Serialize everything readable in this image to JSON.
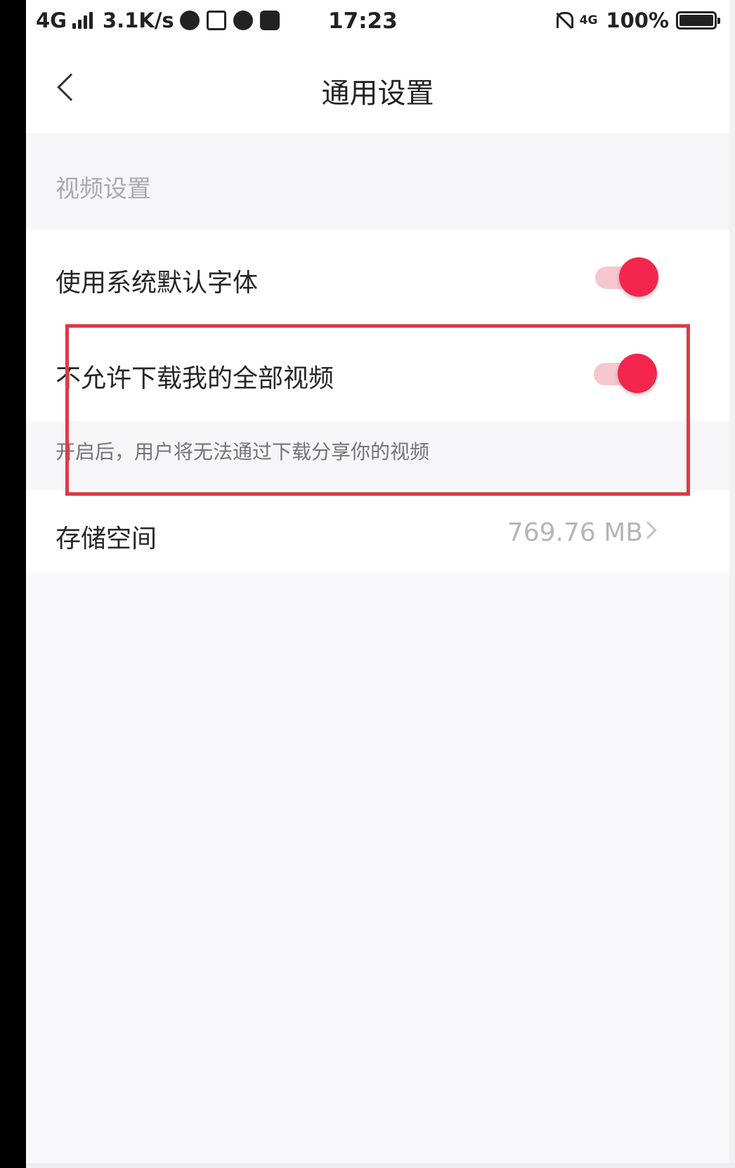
{
  "status_bar": {
    "network": "4G",
    "speed": "3.1K/s",
    "time": "17:23",
    "network_right": "4G",
    "battery": "100%"
  },
  "nav": {
    "title": "通用设置",
    "back_icon": "chevron-left-icon"
  },
  "section": {
    "title": "视频设置"
  },
  "settings": [
    {
      "label": "使用系统默认字体",
      "toggle_on": true
    },
    {
      "label": "不允许下载我的全部视频",
      "toggle_on": true,
      "hint": "开启后，用户将无法通过下载分享你的视频"
    }
  ],
  "storage": {
    "label": "存储空间",
    "value": "769.76 MB"
  },
  "colors": {
    "accent": "#f3254d",
    "annotation": "#dc3b45"
  }
}
